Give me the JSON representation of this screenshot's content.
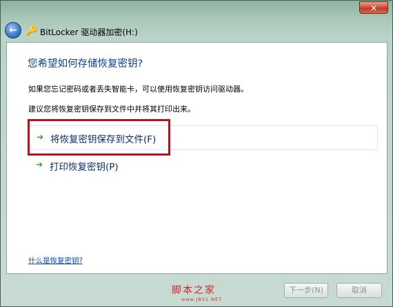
{
  "window": {
    "close_glyph": "✕"
  },
  "nav": {
    "back_glyph": "←",
    "title": "BitLocker 驱动器加密(H:)",
    "app_icon_glyph": "🔑"
  },
  "content": {
    "heading": "您希望如何存储恢复密钥?",
    "description1": "如果您忘记密码或者丢失智能卡，可以使用恢复密钥访问驱动器。",
    "description2": "建议您将恢复密钥保存到文件中并将其打印出来。",
    "options": [
      {
        "arrow": "➔",
        "label": "将恢复密钥保存到文件(F)"
      },
      {
        "arrow": "➔",
        "label": "打印恢复密钥(P)"
      }
    ],
    "help_link": "什么是恢复密钥?"
  },
  "footer": {
    "next_label": "下一步(N)",
    "cancel_label": "取消"
  },
  "watermark": {
    "main": "脚本之家",
    "sub": "www.JB51.NET"
  },
  "colors": {
    "heading": "#0c3f9e",
    "highlight_box": "#b0141d",
    "option_arrow": "#2e9e2e",
    "link": "#0a4bbf"
  }
}
